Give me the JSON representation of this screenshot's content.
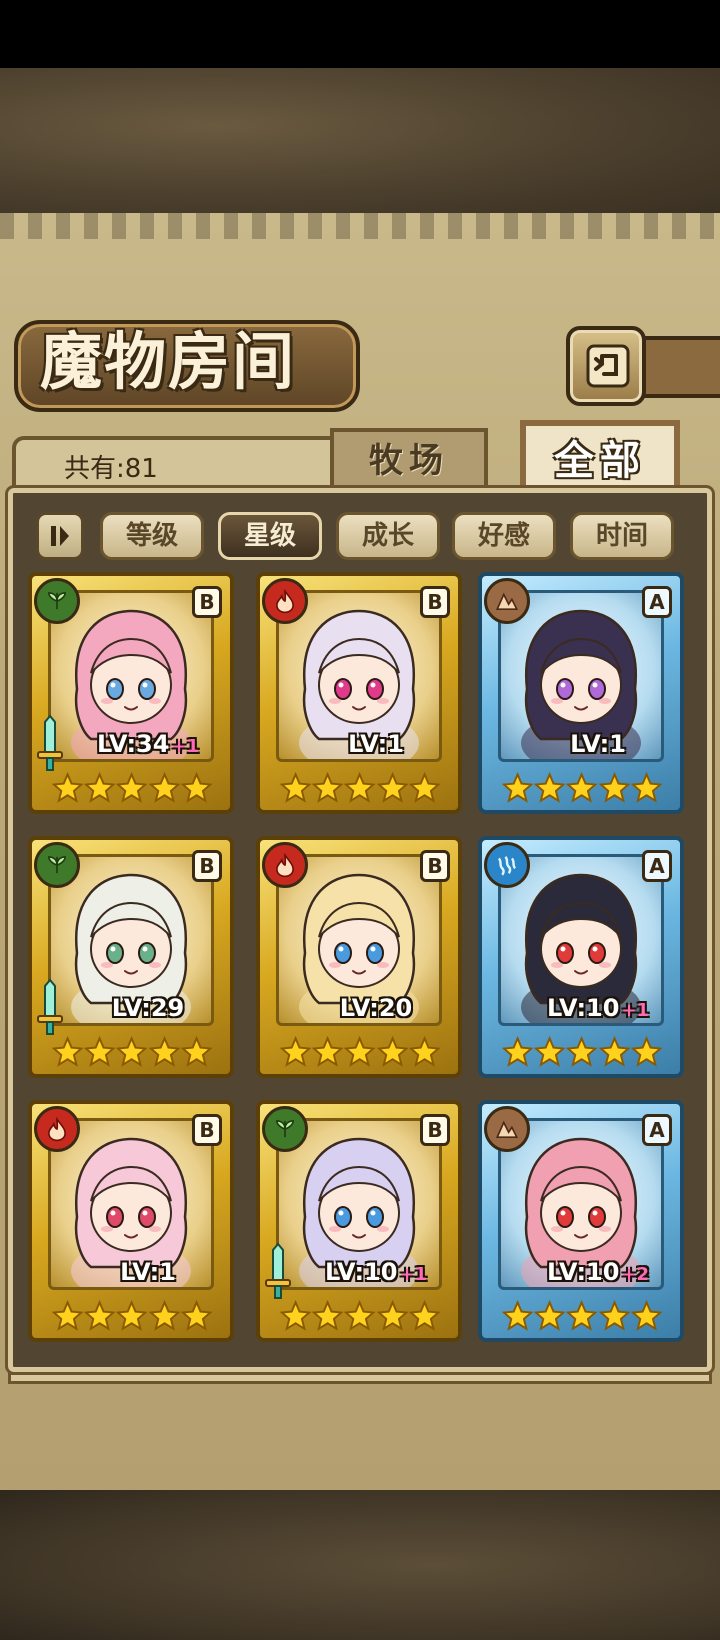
{
  "header": {
    "title": "魔物房间"
  },
  "summary": {
    "total_label": "共有:81"
  },
  "tabs": [
    {
      "label": "牧场",
      "active": false
    },
    {
      "label": "全部",
      "active": true
    }
  ],
  "sort": {
    "toggle_icon": "sort-direction-icon",
    "buttons": [
      {
        "label": "等级",
        "active": false
      },
      {
        "label": "星级",
        "active": true
      },
      {
        "label": "成长",
        "active": false
      },
      {
        "label": "好感",
        "active": false
      },
      {
        "label": "时间",
        "active": false
      }
    ]
  },
  "monsters": [
    {
      "element": "nature",
      "rank": "B",
      "frame": "gold",
      "level": "LV:34",
      "bonus": "+1",
      "weapon": true,
      "stars": 5
    },
    {
      "element": "fire",
      "rank": "B",
      "frame": "gold",
      "level": "LV:1",
      "bonus": "",
      "weapon": false,
      "stars": 5
    },
    {
      "element": "earth",
      "rank": "A",
      "frame": "blue",
      "level": "LV:1",
      "bonus": "",
      "weapon": false,
      "stars": 5
    },
    {
      "element": "nature",
      "rank": "B",
      "frame": "gold",
      "level": "LV:29",
      "bonus": "",
      "weapon": true,
      "stars": 5
    },
    {
      "element": "fire",
      "rank": "B",
      "frame": "gold",
      "level": "LV:20",
      "bonus": "",
      "weapon": false,
      "stars": 5
    },
    {
      "element": "water",
      "rank": "A",
      "frame": "blue",
      "level": "LV:10",
      "bonus": "+1",
      "weapon": false,
      "stars": 5
    },
    {
      "element": "fire",
      "rank": "B",
      "frame": "gold",
      "level": "LV:1",
      "bonus": "",
      "weapon": false,
      "stars": 5
    },
    {
      "element": "nature",
      "rank": "B",
      "frame": "gold",
      "level": "LV:10",
      "bonus": "+1",
      "weapon": true,
      "stars": 5
    },
    {
      "element": "earth",
      "rank": "A",
      "frame": "blue",
      "level": "LV:10",
      "bonus": "+2",
      "weapon": false,
      "stars": 5
    }
  ],
  "colors": {
    "hair": [
      "#f4a8c0",
      "#e8e0f0",
      "#3a3050",
      "#eef0e8",
      "#f6e2a8",
      "#2a2a3a",
      "#f6c8d8",
      "#d8d0f0",
      "#f0a0b0"
    ],
    "eyes": [
      "#6aa8e0",
      "#e03a8a",
      "#b06ad8",
      "#6ab08a",
      "#4a9ae0",
      "#e03a3a",
      "#e04a6a",
      "#4a9ae0",
      "#e03a3a"
    ]
  }
}
